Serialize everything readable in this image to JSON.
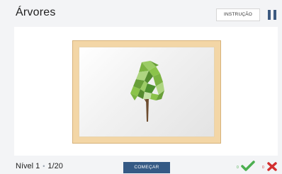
{
  "header": {
    "title": "Árvores",
    "instruction_label": "INSTRUÇÃO",
    "pause_icon": "pause-icon"
  },
  "stage": {
    "image_icon": "tree-icon",
    "colors": {
      "frame": "#f3d6a6",
      "leaf_light": "#8bc34a",
      "leaf_dark": "#4e8f2f",
      "trunk": "#6d4c2f"
    }
  },
  "footer": {
    "level_label": "Nível 1",
    "separator": "•",
    "progress": "1/20",
    "start_label": "COMEÇAR",
    "correct_count": "0",
    "wrong_count": "0",
    "correct_icon": "check-icon",
    "wrong_icon": "x-icon"
  },
  "colors": {
    "accent": "#355a85",
    "correct": "#4caf50",
    "wrong": "#d32f2f"
  }
}
